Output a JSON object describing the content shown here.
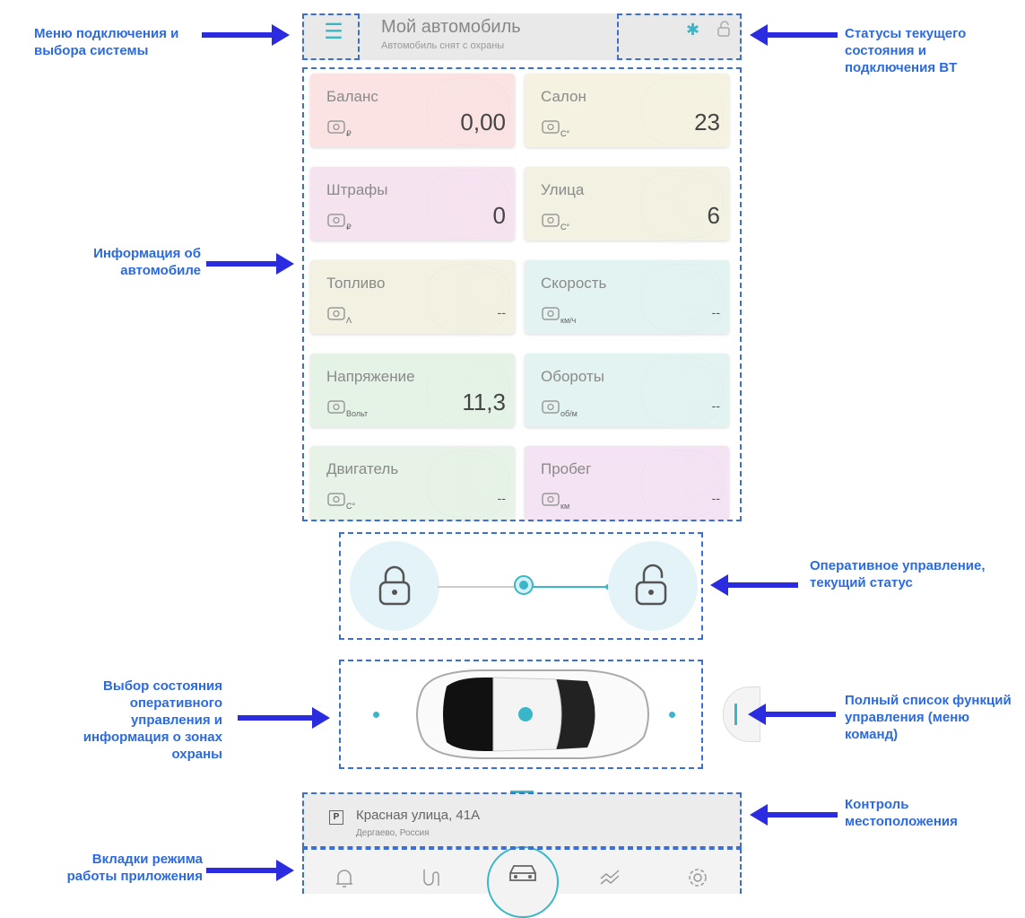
{
  "header": {
    "title": "Мой автомобиль",
    "subtitle": "Автомобиль снят с охраны",
    "menu_icon": "hamburger-icon",
    "status_icons": [
      "bluetooth-icon",
      "lock-open-icon"
    ]
  },
  "cards": [
    {
      "id": "balance",
      "title": "Баланс",
      "value": "0,00",
      "icon": "wallet-icon",
      "color": "#fbe3e3"
    },
    {
      "id": "cabin",
      "title": "Салон",
      "value": "23",
      "icon": "steering-wheel-icon",
      "color": "#f5f2e2"
    },
    {
      "id": "fines",
      "title": "Штрафы",
      "value": "0",
      "icon": "camera-icon",
      "color": "#f6e3f0"
    },
    {
      "id": "street",
      "title": "Улица",
      "value": "6",
      "icon": "cloud-icon",
      "color": "#f3f2e2"
    },
    {
      "id": "fuel",
      "title": "Топливо",
      "value": "--",
      "icon": "fuel-icon",
      "color": "#f2f1e2"
    },
    {
      "id": "speed",
      "title": "Скорость",
      "value": "--",
      "icon": "speedometer-icon",
      "color": "#e3f3f2"
    },
    {
      "id": "voltage",
      "title": "Напряжение",
      "value": "11,3",
      "icon": "battery-icon",
      "color": "#e5f3e6"
    },
    {
      "id": "rpm",
      "title": "Обороты",
      "value": "--",
      "icon": "tachometer-icon",
      "color": "#e3f3f1"
    },
    {
      "id": "engine",
      "title": "Двигатель",
      "value": "--",
      "icon": "engine-icon",
      "color": "#e6f3e6"
    },
    {
      "id": "mileage",
      "title": "Пробег",
      "value": "--",
      "icon": "odometer-icon",
      "color": "#f3e3f3"
    }
  ],
  "card_units": {
    "balance": "₽",
    "cabin": "C°",
    "fines": "₽",
    "street": "C°",
    "fuel": "Λ",
    "speed": "км/ч",
    "voltage": "Вольт",
    "rpm": "об/м",
    "engine": "C°",
    "mileage": "км"
  },
  "location": {
    "parking_badge": "P",
    "street": "Красная улица, 41А",
    "city": "Дергаево, Россия"
  },
  "tabs": [
    "bell-icon",
    "route-icon",
    "car-icon",
    "chart-icon",
    "gear-icon"
  ],
  "annotations": {
    "menu": "Меню подключения и выбора системы",
    "status": "Статусы текущего состояния и подключения BT",
    "info": "Информация об автомобиле",
    "control": "Оперативное управление, текущий статус",
    "select": "Выбор состояния оперативного управления и информация о зонах охраны",
    "commands": "Полный список функций управления (меню команд)",
    "location": "Контроль местоположения",
    "tabs": "Вкладки режима работы приложения"
  },
  "colors": {
    "accent": "#39b6c8",
    "annotation": "#2c6ae0",
    "arrow": "#2b2be0"
  }
}
